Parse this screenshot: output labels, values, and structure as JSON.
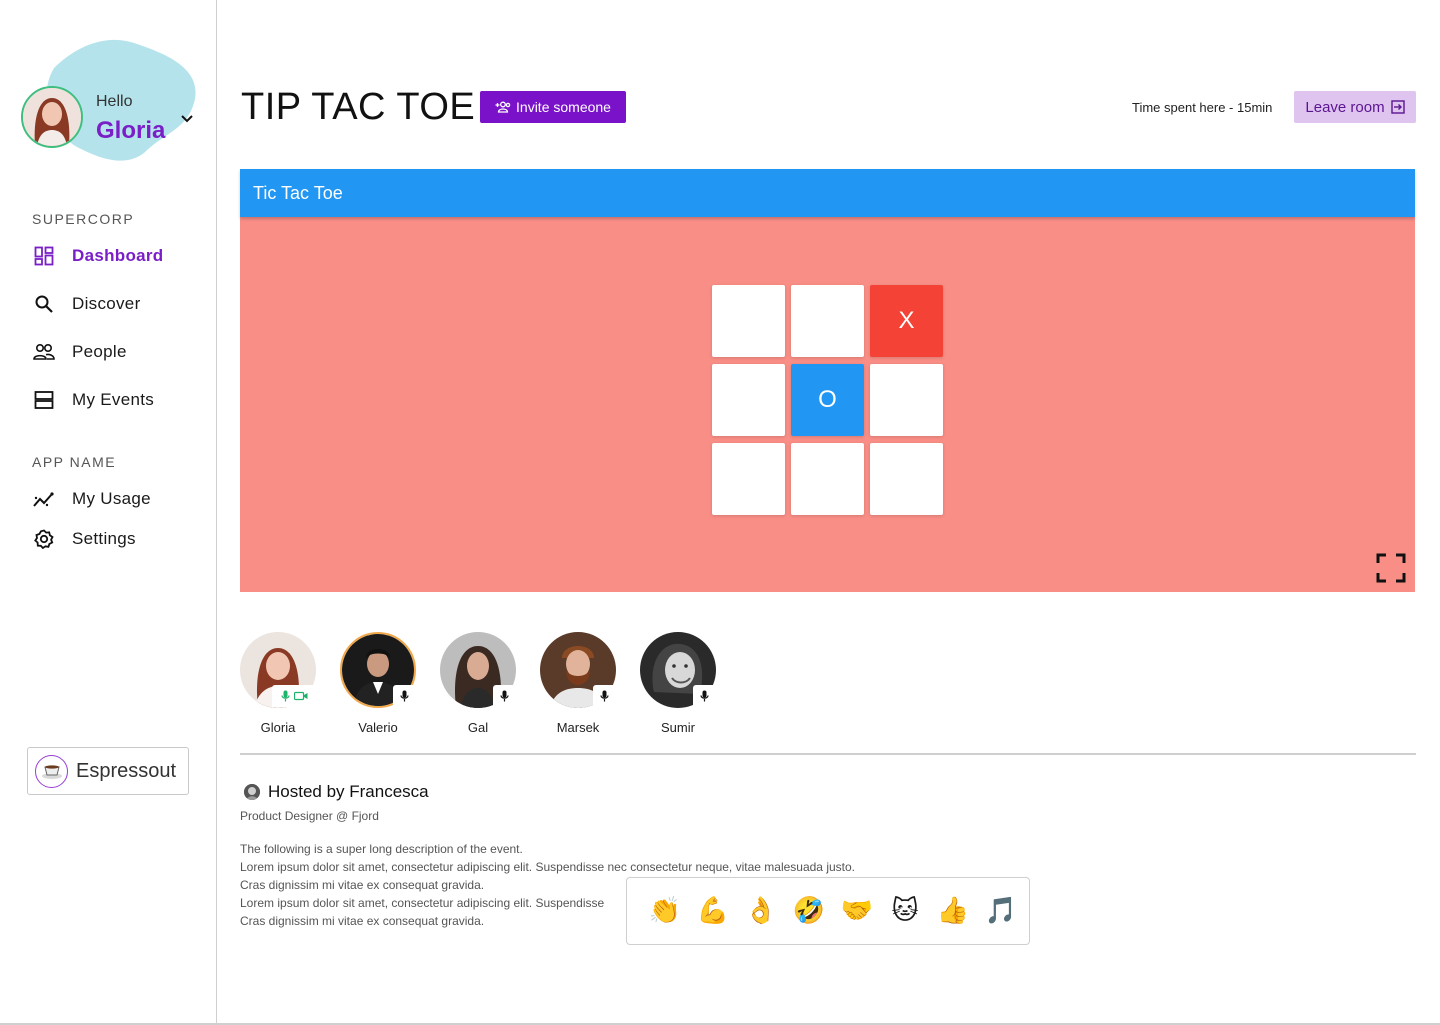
{
  "user": {
    "greeting": "Hello",
    "name": "Gloria"
  },
  "sidebar": {
    "sections": [
      {
        "label": "SUPERCORP",
        "items": [
          {
            "label": "Dashboard",
            "icon": "dashboard-icon",
            "active": true
          },
          {
            "label": "Discover",
            "icon": "search-icon"
          },
          {
            "label": "People",
            "icon": "people-icon"
          },
          {
            "label": "My Events",
            "icon": "events-icon"
          }
        ]
      },
      {
        "label": "APP NAME",
        "items": [
          {
            "label": "My Usage",
            "icon": "usage-icon"
          },
          {
            "label": "Settings",
            "icon": "settings-icon"
          }
        ]
      }
    ],
    "company": {
      "name": "Espressout",
      "icon": "coffee-icon"
    }
  },
  "header": {
    "title": "TIP TAC TOE",
    "invite_label": "Invite someone",
    "time_spent": "Time spent here - 15min",
    "leave_label": "Leave room"
  },
  "game": {
    "title": "Tic Tac Toe",
    "board": [
      "",
      "",
      "X",
      "",
      "O",
      "",
      "",
      "",
      ""
    ]
  },
  "participants": [
    {
      "name": "Gloria"
    },
    {
      "name": "Valerio"
    },
    {
      "name": "Gal"
    },
    {
      "name": "Marsek"
    },
    {
      "name": "Sumir"
    }
  ],
  "host": {
    "line": "Hosted by Francesca",
    "role": "Product Designer @ Fjord"
  },
  "description": [
    "The following is a super long description of the event.",
    "Lorem ipsum dolor sit amet, consectetur adipiscing elit. Suspendisse nec consectetur neque, vitae malesuada justo.",
    "Cras dignissim mi vitae ex consequat gravida.",
    "Lorem ipsum dolor sit amet, consectetur adipiscing elit. Suspendisse",
    "Cras dignissim mi vitae ex consequat gravida."
  ],
  "reactions": [
    "👏",
    "💪",
    "👌",
    "🤣",
    "🤝",
    "🐱",
    "👍",
    "🎵"
  ],
  "colors": {
    "accent": "#7a12c9",
    "game_header": "#2196f3",
    "game_bg": "#f88e86",
    "x_cell": "#f44336",
    "o_cell": "#2196f3"
  }
}
